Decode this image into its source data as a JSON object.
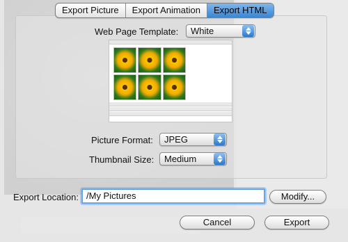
{
  "tabs": [
    {
      "label": "Export Picture",
      "active": false
    },
    {
      "label": "Export Animation",
      "active": false
    },
    {
      "label": "Export HTML",
      "active": true
    }
  ],
  "template": {
    "label": "Web Page Template:",
    "value": "White"
  },
  "picture_format": {
    "label": "Picture Format:",
    "value": "JPEG"
  },
  "thumbnail_size": {
    "label": "Thumbnail Size:",
    "value": "Medium"
  },
  "export_location": {
    "label": "Export Location:",
    "value": "/My Pictures"
  },
  "buttons": {
    "modify": "Modify...",
    "cancel": "Cancel",
    "export": "Export"
  },
  "colors": {
    "accent": "#3a86d4",
    "focus_ring": "#6aa4e8"
  },
  "icons": {
    "popup_arrows": "up-down-arrows-icon"
  }
}
